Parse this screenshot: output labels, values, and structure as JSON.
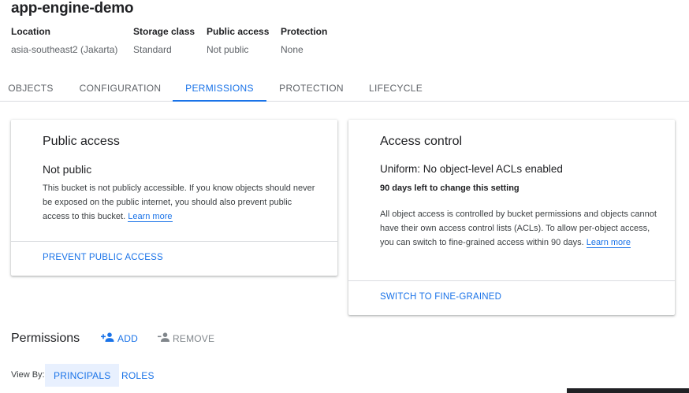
{
  "bucket": {
    "name": "app-engine-demo",
    "meta": [
      {
        "label": "Location",
        "value": "asia-southeast2 (Jakarta)"
      },
      {
        "label": "Storage class",
        "value": "Standard"
      },
      {
        "label": "Public access",
        "value": "Not public"
      },
      {
        "label": "Protection",
        "value": "None"
      }
    ]
  },
  "tabs": [
    {
      "label": "OBJECTS",
      "active": false
    },
    {
      "label": "CONFIGURATION",
      "active": false
    },
    {
      "label": "PERMISSIONS",
      "active": true
    },
    {
      "label": "PROTECTION",
      "active": false
    },
    {
      "label": "LIFECYCLE",
      "active": false
    }
  ],
  "public_access_card": {
    "title": "Public access",
    "status": "Not public",
    "description": "This bucket is not publicly accessible. If you know objects should never be exposed on the public internet, you should also prevent public access to this bucket.",
    "learn_more": "Learn more",
    "action": "PREVENT PUBLIC ACCESS"
  },
  "access_control_card": {
    "title": "Access control",
    "status": "Uniform: No object-level ACLs enabled",
    "subtext": "90 days left to change this setting",
    "description": "All object access is controlled by bucket permissions and objects cannot have their own access control lists (ACLs). To allow per-object access, you can switch to fine-grained access within 90 days.",
    "learn_more": "Learn more",
    "action": "SWITCH TO FINE-GRAINED"
  },
  "permissions": {
    "title": "Permissions",
    "add_label": "ADD",
    "remove_label": "REMOVE",
    "view_by_label": "View By:",
    "view_by_options": [
      {
        "label": "PRINCIPALS",
        "active": true
      },
      {
        "label": "ROLES",
        "active": false
      }
    ]
  },
  "colors": {
    "accent": "#1a73e8",
    "text_primary": "#202124",
    "text_secondary": "#5f6368",
    "divider": "#dadce0",
    "disabled": "#80868b",
    "selected_bg": "#e8f0fe"
  },
  "icons": {
    "add": "add-person-icon",
    "remove": "remove-person-icon"
  }
}
